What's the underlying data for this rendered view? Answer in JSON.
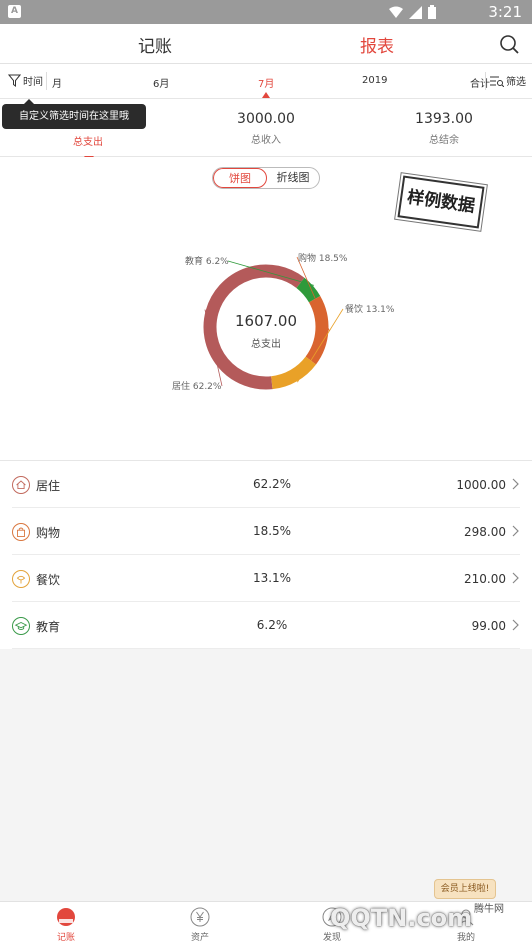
{
  "status_bar": {
    "time": "3:21"
  },
  "header": {
    "tab_left": "记账",
    "tab_right": "报表"
  },
  "period_bar": {
    "time_filter_label": "时间",
    "periods": [
      "月",
      "6月",
      "7月",
      "2019",
      "合计"
    ],
    "active_period": "7月",
    "filter_label": "筛选"
  },
  "tooltip": {
    "text": "自定义筛选时间在这里哦"
  },
  "summary": {
    "items": [
      {
        "value": "",
        "label": "总支出"
      },
      {
        "value": "3000.00",
        "label": "总收入"
      },
      {
        "value": "1393.00",
        "label": "总结余"
      }
    ]
  },
  "chart_toggle": {
    "pie": "饼图",
    "line": "折线图",
    "active": "饼图"
  },
  "stamp": {
    "text": "样例数据"
  },
  "chart_data": {
    "type": "pie",
    "donut": true,
    "center_value": "1607.00",
    "center_label": "总支出",
    "slices": [
      {
        "label": "居住",
        "percent": 62.2,
        "value": 1000.0,
        "color": "#b45a5a",
        "tag": "居住 62.2%"
      },
      {
        "label": "购物",
        "percent": 18.5,
        "value": 298.0,
        "color": "#d9642f",
        "tag": "购物 18.5%"
      },
      {
        "label": "餐饮",
        "percent": 13.1,
        "value": 210.0,
        "color": "#e9a128",
        "tag": "餐饮 13.1%"
      },
      {
        "label": "教育",
        "percent": 6.2,
        "value": 99.0,
        "color": "#2f9a3b",
        "tag": "教育 6.2%"
      }
    ]
  },
  "list": {
    "rows": [
      {
        "name": "居住",
        "percent": "62.2%",
        "amount": "1000.00",
        "icon": "home-icon",
        "color": "#c26a5e"
      },
      {
        "name": "购物",
        "percent": "18.5%",
        "amount": "298.00",
        "icon": "shopping-bag-icon",
        "color": "#d9773f"
      },
      {
        "name": "餐饮",
        "percent": "13.1%",
        "amount": "210.00",
        "icon": "dining-icon",
        "color": "#e3a33a"
      },
      {
        "name": "教育",
        "percent": "6.2%",
        "amount": "99.00",
        "icon": "education-icon",
        "color": "#3a9a4a"
      }
    ]
  },
  "bottom_nav": {
    "items": [
      {
        "label": "记账",
        "icon": "ledger-icon"
      },
      {
        "label": "资产",
        "icon": "yen-icon"
      },
      {
        "label": "发现",
        "icon": "discover-icon"
      },
      {
        "label": "我的",
        "icon": "profile-icon"
      }
    ],
    "active": "记账",
    "badge": "会员上线啦!"
  },
  "watermark": {
    "logo": "QQTN.com",
    "site": "腾牛网"
  },
  "colors": {
    "accent": "#e2473d"
  }
}
